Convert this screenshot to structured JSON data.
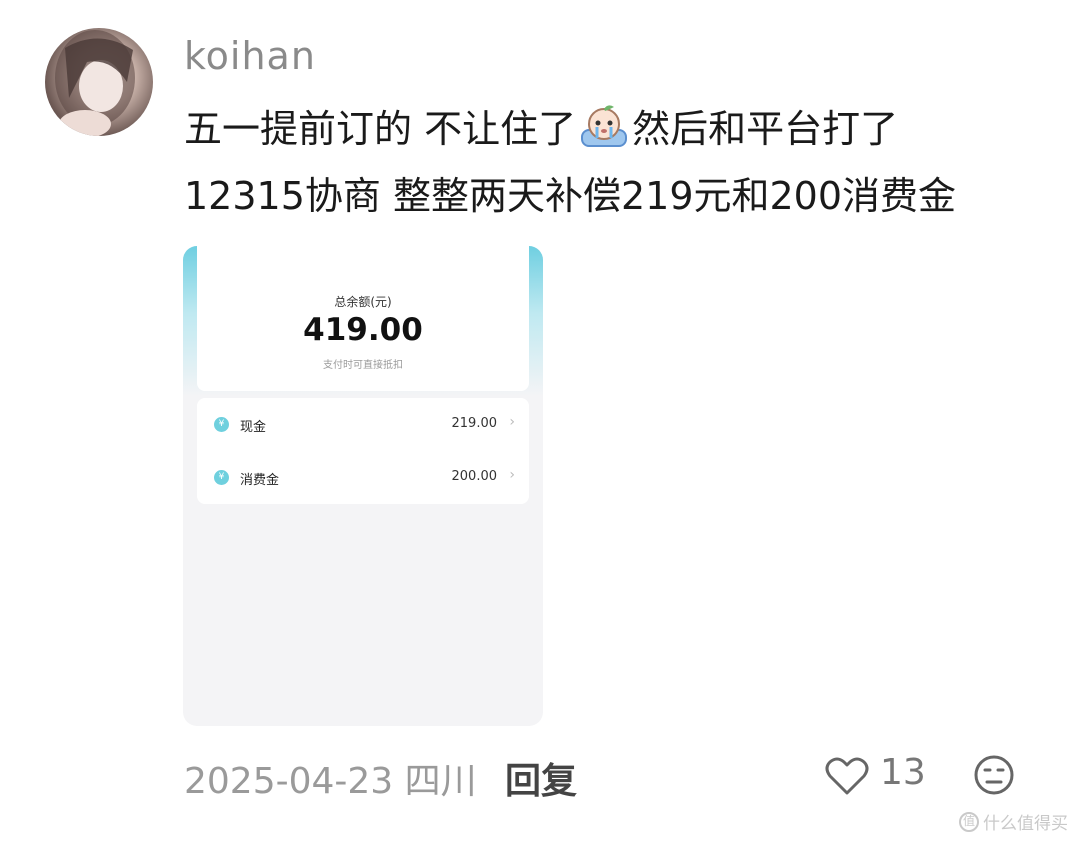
{
  "comment": {
    "username": "koihan",
    "text_line1_part1": "五一提前订的 不让住了",
    "text_line1_part2": "然后和平台打了",
    "text_line2": "12315协商 整整两天补偿219元和200消费金",
    "emoji_icon": "crying-peach-emoji-icon",
    "date": "2025-04-23",
    "location": "四川",
    "reply_label": "回复",
    "like_count": "13"
  },
  "screenshot": {
    "total_label": "总余额(元)",
    "total_amount": "419.00",
    "total_note": "支付时可直接抵扣",
    "items": [
      {
        "icon": "yen-coin-icon",
        "label": "现金",
        "value": "219.00"
      },
      {
        "icon": "yen-coin-icon",
        "label": "消费金",
        "value": "200.00"
      }
    ],
    "accent_color": "#6fcfe1"
  },
  "watermark": {
    "text": "什么值得买"
  }
}
